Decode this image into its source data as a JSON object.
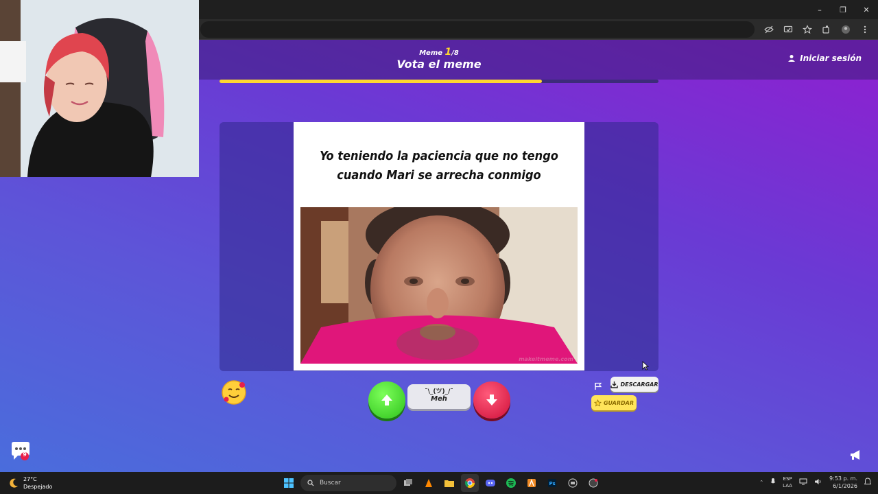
{
  "window": {
    "controls": [
      "–",
      "❐",
      "✕"
    ]
  },
  "header": {
    "counter_prefix": "Meme ",
    "counter_current": "1",
    "counter_total": "/8",
    "title": "Vota el meme",
    "login_label": "Iniciar sesión"
  },
  "progress": {
    "fraction": 0.735,
    "color": "#ffd630"
  },
  "meme": {
    "caption": "Yo teniendo la paciencia que no tengo cuando Mari se arrecha conmigo",
    "watermark": "makeitmeme.com"
  },
  "controls": {
    "meh_face": "¯\\_(ツ)_/¯",
    "meh_label": "Meh",
    "download_label": "DESCARGAR",
    "save_label": "GUARDAR",
    "chat_badge": "9"
  },
  "taskbar": {
    "temperature": "27°C",
    "weather": "Despejado",
    "search_placeholder": "Buscar",
    "lang": "ESP",
    "lang_sub": "LAA",
    "time": "9:53 p. m.",
    "date": "6/1/2026"
  },
  "colors": {
    "accent_yellow": "#ffd630",
    "vote_up": "#2ec21c",
    "vote_down": "#d0103a",
    "page_top": "#8f1fd0",
    "page_bottom": "#4a6ddc"
  }
}
